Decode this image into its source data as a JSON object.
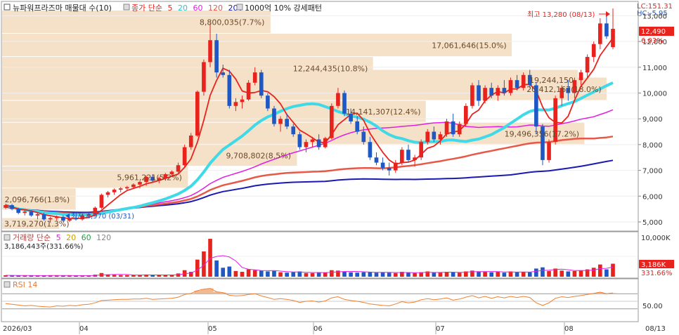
{
  "header": {
    "stock_title": "뉴파워프라즈마 매물대 수(10)",
    "ma_prefix": "종가 단순",
    "ma_periods": [
      "5",
      "20",
      "60",
      "120",
      "200"
    ],
    "pattern_label": "1000억 10% 강세패턴",
    "lc_label": "LC:151.31",
    "hc_label": "HC:-5.95"
  },
  "price_pane": {
    "high_annotation": "최고 13,280 (08/13)",
    "low_annotation": "최저 4,970 (03/31)",
    "current_price": "12,490",
    "current_change": "6.03%",
    "y_ticks": [
      "13,000",
      "12,000",
      "11,000",
      "10,000",
      "9,000",
      "8,000",
      "7,000",
      "6,000",
      "5,000"
    ]
  },
  "volume_pane": {
    "header_prefix": "거래량 단순",
    "ma_periods": [
      "5",
      "20",
      "60",
      "120"
    ],
    "current_label": "3,186,443주(331.66%)",
    "y_tick_max": "10,000K",
    "current_value": "3,186K",
    "current_pct": "331.66%"
  },
  "rsi_pane": {
    "header": "RSI 14",
    "y_tick": "50.00"
  },
  "x_axis": {
    "labels": [
      "2026/03",
      "04",
      "05",
      "06",
      "07",
      "08"
    ],
    "last_date": "08/13"
  },
  "colors": {
    "up": "#e8231d",
    "down": "#1f57c4",
    "ma5": "#e8231d",
    "ma20": "#3fd9e8",
    "ma60": "#e020e0",
    "ma120": "#e85848",
    "ma200": "#1a1ab0",
    "volume_profile": "#f5e1c8",
    "rsi": "#f08030"
  },
  "chart_data": {
    "type": "candlestick",
    "ylim": [
      4700,
      13500
    ],
    "volume_profile": [
      {
        "price_from": 4700,
        "price_to": 5150,
        "volume_label": "3,719,270(1.3%)"
      },
      {
        "price_from": 5450,
        "price_to": 6300,
        "volume_label": "2,096,766(1.8%)"
      },
      {
        "price_from": 6300,
        "price_to": 7150,
        "volume_label": "5,961,221(5.2%)"
      },
      {
        "price_from": 7150,
        "price_to": 8000,
        "volume_label": "9,708,802(8.5%)"
      },
      {
        "price_from": 8000,
        "price_to": 8850,
        "volume_label": "19,496,356(17.2%)"
      },
      {
        "price_from": 8850,
        "price_to": 9700,
        "volume_label": "14,141,307(12.4%)"
      },
      {
        "price_from": 9700,
        "price_to": 10600,
        "volume_label": "20,412,167(18.0%)"
      },
      {
        "price_from": 10100,
        "price_to": 10900,
        "volume_label": "19,244,150"
      },
      {
        "price_from": 10500,
        "price_to": 11400,
        "volume_label": "12,244,435(10.8%)"
      },
      {
        "price_from": 11400,
        "price_to": 12300,
        "volume_label": "17,061,646(15.0%)"
      },
      {
        "price_from": 12300,
        "price_to": 13200,
        "volume_label": "8,800,035(7.7%)"
      }
    ],
    "candles": [
      [
        5550,
        5700,
        5500,
        5650
      ],
      [
        5650,
        5700,
        5450,
        5500
      ],
      [
        5500,
        5550,
        5300,
        5350
      ],
      [
        5350,
        5450,
        5250,
        5400
      ],
      [
        5400,
        5450,
        5200,
        5250
      ],
      [
        5250,
        5350,
        5100,
        5300
      ],
      [
        5300,
        5350,
        5050,
        5100
      ],
      [
        5100,
        5200,
        4970,
        5150
      ],
      [
        5150,
        5250,
        5050,
        5200
      ],
      [
        5200,
        5250,
        5000,
        5050
      ],
      [
        5050,
        5200,
        5000,
        5150
      ],
      [
        5150,
        5200,
        5050,
        5100
      ],
      [
        5100,
        5300,
        5050,
        5250
      ],
      [
        5250,
        5350,
        5150,
        5300
      ],
      [
        5300,
        5600,
        5250,
        5550
      ],
      [
        5550,
        6100,
        5500,
        6050
      ],
      [
        6050,
        6200,
        5950,
        6150
      ],
      [
        6150,
        6300,
        6050,
        6250
      ],
      [
        6250,
        6350,
        6150,
        6300
      ],
      [
        6300,
        6400,
        6250,
        6350
      ],
      [
        6350,
        6500,
        6300,
        6450
      ],
      [
        6450,
        6600,
        6300,
        6550
      ],
      [
        6550,
        6800,
        6400,
        6750
      ],
      [
        6750,
        6850,
        6550,
        6600
      ],
      [
        6600,
        6750,
        6500,
        6700
      ],
      [
        6700,
        6900,
        6600,
        6850
      ],
      [
        6850,
        7000,
        6750,
        6950
      ],
      [
        6950,
        7300,
        6900,
        7200
      ],
      [
        7200,
        8000,
        7100,
        7900
      ],
      [
        7900,
        8450,
        7800,
        8350
      ],
      [
        8350,
        10100,
        8300,
        10050
      ],
      [
        10050,
        11300,
        9900,
        11200
      ],
      [
        11200,
        12700,
        11000,
        12050
      ],
      [
        12050,
        12300,
        10600,
        10800
      ],
      [
        10800,
        11100,
        10600,
        10700
      ],
      [
        10700,
        10900,
        9400,
        9500
      ],
      [
        9500,
        9800,
        9300,
        9650
      ],
      [
        9650,
        9900,
        9400,
        9750
      ],
      [
        9750,
        10500,
        9700,
        10400
      ],
      [
        10400,
        11000,
        10300,
        10800
      ],
      [
        10800,
        10900,
        9800,
        9900
      ],
      [
        9900,
        10000,
        9300,
        9400
      ],
      [
        9400,
        9500,
        8700,
        8800
      ],
      [
        8800,
        9100,
        8500,
        9000
      ],
      [
        9000,
        9200,
        8600,
        8700
      ],
      [
        8700,
        8800,
        8300,
        8400
      ],
      [
        8400,
        8500,
        7800,
        7900
      ],
      [
        7900,
        8200,
        7700,
        8100
      ],
      [
        8100,
        8300,
        7900,
        8200
      ],
      [
        8200,
        8400,
        7800,
        7900
      ],
      [
        7900,
        8300,
        7850,
        8250
      ],
      [
        8250,
        9600,
        8200,
        9500
      ],
      [
        9500,
        10200,
        9400,
        10000
      ],
      [
        10000,
        10100,
        9100,
        9200
      ],
      [
        9200,
        9400,
        8800,
        8900
      ],
      [
        8900,
        9100,
        8400,
        8500
      ],
      [
        8500,
        8700,
        8000,
        8100
      ],
      [
        8100,
        8300,
        7400,
        7500
      ],
      [
        7500,
        7700,
        7200,
        7300
      ],
      [
        7300,
        7500,
        7000,
        7100
      ],
      [
        7100,
        7300,
        6800,
        7000
      ],
      [
        7000,
        7400,
        6900,
        7300
      ],
      [
        7300,
        7900,
        7200,
        7800
      ],
      [
        7800,
        8000,
        7300,
        7400
      ],
      [
        7400,
        7600,
        7150,
        7500
      ],
      [
        7500,
        8200,
        7400,
        8100
      ],
      [
        8100,
        8600,
        8000,
        8500
      ],
      [
        8500,
        8700,
        8100,
        8200
      ],
      [
        8200,
        8500,
        8000,
        8400
      ],
      [
        8400,
        9000,
        8300,
        8900
      ],
      [
        8900,
        9200,
        8300,
        8400
      ],
      [
        8400,
        8900,
        8300,
        8800
      ],
      [
        8800,
        9600,
        8700,
        9500
      ],
      [
        9500,
        10400,
        9400,
        10300
      ],
      [
        10300,
        10500,
        9500,
        9700
      ],
      [
        9700,
        10300,
        9600,
        10200
      ],
      [
        10200,
        10400,
        9800,
        9900
      ],
      [
        9900,
        10300,
        9700,
        10200
      ],
      [
        10200,
        10500,
        9900,
        10000
      ],
      [
        10000,
        10600,
        9900,
        10500
      ],
      [
        10500,
        10700,
        10100,
        10200
      ],
      [
        10200,
        10800,
        10100,
        10700
      ],
      [
        10700,
        10900,
        10200,
        10300
      ],
      [
        10300,
        10400,
        8400,
        8700
      ],
      [
        8700,
        8800,
        7200,
        7400
      ],
      [
        7400,
        8200,
        7300,
        8100
      ],
      [
        8100,
        9900,
        8000,
        9800
      ],
      [
        9800,
        10300,
        9500,
        10200
      ],
      [
        10200,
        10500,
        9700,
        10000
      ],
      [
        10000,
        10600,
        9800,
        10500
      ],
      [
        10500,
        10900,
        10300,
        10800
      ],
      [
        10800,
        11500,
        10600,
        11400
      ],
      [
        11400,
        12000,
        11200,
        11900
      ],
      [
        11900,
        12900,
        11700,
        12700
      ],
      [
        12700,
        13000,
        12100,
        12200
      ],
      [
        11780,
        13280,
        11700,
        12490
      ]
    ],
    "volumes": [
      0.35,
      0.3,
      0.28,
      0.25,
      0.3,
      0.26,
      0.3,
      0.35,
      0.28,
      0.25,
      0.27,
      0.24,
      0.3,
      0.28,
      0.5,
      0.9,
      0.5,
      0.45,
      0.4,
      0.38,
      0.4,
      0.42,
      0.55,
      0.4,
      0.38,
      0.4,
      0.45,
      0.8,
      1.6,
      1.2,
      4.2,
      6.2,
      9.3,
      4.0,
      2.2,
      2.5,
      1.4,
      1.2,
      1.8,
      1.6,
      1.5,
      1.3,
      1.4,
      1.1,
      1.0,
      1.1,
      1.3,
      0.9,
      0.9,
      1.0,
      1.0,
      1.6,
      1.5,
      1.3,
      1.1,
      1.0,
      1.1,
      1.2,
      1.0,
      1.1,
      1.0,
      0.9,
      1.2,
      1.0,
      0.9,
      1.1,
      1.3,
      1.0,
      1.0,
      1.2,
      1.1,
      1.0,
      1.3,
      1.5,
      1.3,
      1.2,
      1.1,
      1.2,
      1.0,
      1.3,
      1.1,
      1.2,
      1.1,
      2.0,
      2.3,
      1.4,
      2.0,
      1.5,
      1.3,
      1.4,
      1.5,
      1.8,
      2.2,
      3.0,
      1.8,
      3.19
    ],
    "volume_ylim": [
      0,
      10000
    ],
    "rsi": [
      44,
      42,
      40,
      38,
      39,
      37,
      36,
      35,
      38,
      37,
      39,
      38,
      41,
      42,
      46,
      52,
      53,
      54,
      55,
      55,
      56,
      56,
      58,
      55,
      56,
      57,
      58,
      61,
      68,
      71,
      78,
      82,
      84,
      75,
      73,
      66,
      64,
      65,
      68,
      70,
      64,
      60,
      55,
      57,
      55,
      52,
      47,
      50,
      51,
      48,
      51,
      59,
      62,
      55,
      52,
      50,
      47,
      43,
      41,
      39,
      38,
      43,
      49,
      46,
      48,
      54,
      57,
      54,
      56,
      59,
      53,
      56,
      61,
      65,
      59,
      63,
      58,
      62,
      59,
      63,
      60,
      63,
      60,
      46,
      39,
      46,
      58,
      62,
      60,
      63,
      65,
      68,
      71,
      74,
      70,
      72
    ],
    "rsi_ylim": [
      0,
      100
    ]
  }
}
